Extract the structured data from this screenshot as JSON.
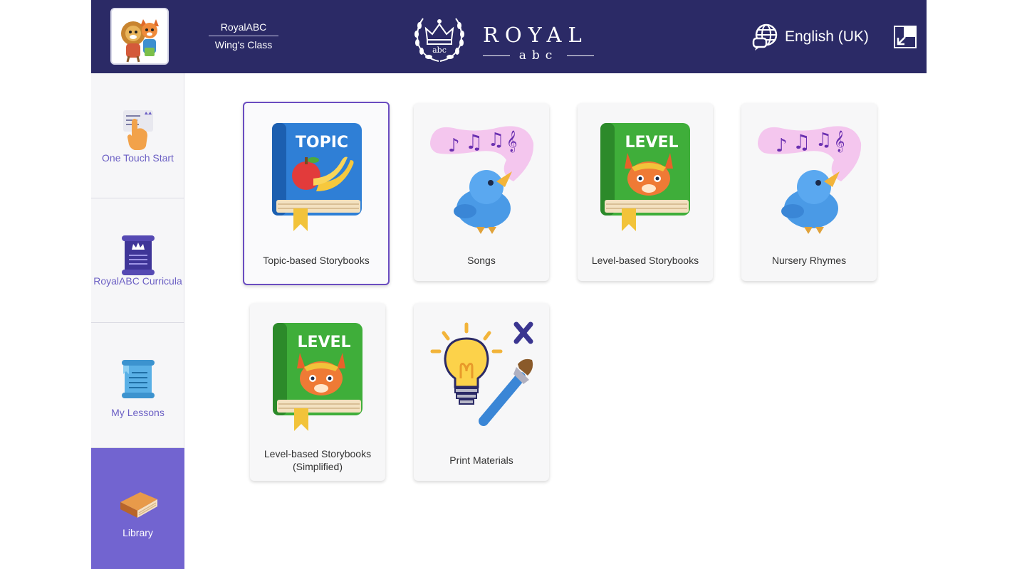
{
  "header": {
    "org_name": "RoyalABC",
    "class_name": "Wing's Class",
    "logo_brand": "ROYAL",
    "logo_sub": "abc",
    "crest_text": "abc",
    "language": "English (UK)",
    "icons": {
      "avatar": "avatar-characters-icon",
      "language": "globe-chat-icon",
      "fullscreen": "exit-fullscreen-icon"
    },
    "colors": {
      "bar": "#2b2a66"
    }
  },
  "sidebar": {
    "items": [
      {
        "label": "One Touch Start",
        "icon": "hand-touch-icon"
      },
      {
        "label": "RoyalABC Curricula",
        "icon": "scroll-crown-icon"
      },
      {
        "label": "My Lessons",
        "icon": "scroll-icon"
      },
      {
        "label": "Library",
        "icon": "book-icon",
        "active": true
      }
    ],
    "colors": {
      "active_bg": "#7264d0",
      "label": "#6b5fc4"
    }
  },
  "library": {
    "cards": [
      {
        "title": "Topic-based Storybooks",
        "icon": "topic-book-icon",
        "book_label": "TOPIC",
        "selected": true
      },
      {
        "title": "Songs",
        "icon": "singing-bird-icon"
      },
      {
        "title": "Level-based Storybooks",
        "icon": "level-book-icon",
        "book_label": "LEVEL"
      },
      {
        "title": "Nursery Rhymes",
        "icon": "singing-bird-icon"
      },
      {
        "title": "Level-based Storybooks (Simplified)",
        "icon": "level-book-icon",
        "book_label": "LEVEL"
      },
      {
        "title": "Print Materials",
        "icon": "lightbulb-paintbrush-icon"
      }
    ],
    "colors": {
      "selected_border": "#6a4cc0"
    }
  }
}
